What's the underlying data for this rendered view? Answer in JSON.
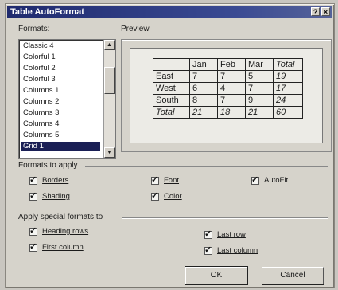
{
  "window": {
    "title": "Table AutoFormat",
    "help_button": "?",
    "close_button": "×"
  },
  "formats": {
    "label": "Formats:",
    "items": [
      "Classic 4",
      "Colorful 1",
      "Colorful 2",
      "Colorful 3",
      "Columns 1",
      "Columns 2",
      "Columns 3",
      "Columns 4",
      "Columns 5",
      "Grid 1"
    ],
    "selected": "Grid 1"
  },
  "preview": {
    "label": "Preview",
    "header": [
      "",
      "Jan",
      "Feb",
      "Mar",
      "Total"
    ],
    "rows": [
      [
        "East",
        "7",
        "7",
        "5",
        "19"
      ],
      [
        "West",
        "6",
        "4",
        "7",
        "17"
      ],
      [
        "South",
        "8",
        "7",
        "9",
        "24"
      ],
      [
        "Total",
        "21",
        "18",
        "21",
        "60"
      ]
    ]
  },
  "formats_to_apply": {
    "label": "Formats to apply",
    "borders": {
      "label": "Borders",
      "checked": true
    },
    "shading": {
      "label": "Shading",
      "checked": true
    },
    "font": {
      "label": "Font",
      "checked": true
    },
    "color": {
      "label": "Color",
      "checked": true
    },
    "autofit": {
      "label": "AutoFit",
      "checked": true
    }
  },
  "special_formats": {
    "label": "Apply special formats to",
    "heading_rows": {
      "label": "Heading rows",
      "checked": true
    },
    "first_column": {
      "label": "First column",
      "checked": true
    },
    "last_row": {
      "label": "Last row",
      "checked": true
    },
    "last_column": {
      "label": "Last column",
      "checked": true
    }
  },
  "buttons": {
    "ok": "OK",
    "cancel": "Cancel"
  }
}
